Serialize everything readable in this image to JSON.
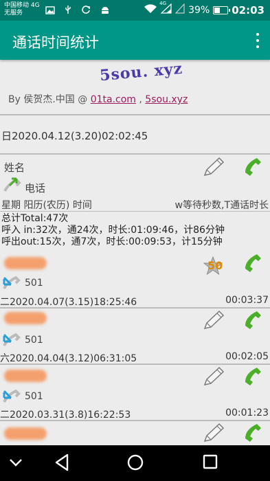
{
  "status_bar": {
    "carrier_line1": "中国移动 4G",
    "carrier_line2": "无服务",
    "network": "4G",
    "battery": "39%",
    "battery_level": 0.39,
    "time": "02:03"
  },
  "app_bar": {
    "title": "通话时间统计"
  },
  "header": {
    "logo": "5sou. xyz",
    "by_prefix": "By 侯贺杰.中国 @ ",
    "link1": "01ta.com",
    "separator": " , ",
    "link2": "5sou.xyz",
    "current_datetime": "日2020.04.12(3.20)02:02:45"
  },
  "legend": {
    "name_label": "姓名",
    "phone_label": "电话",
    "left": "星期 阳历(农历) 时间",
    "right": "w等待秒数,T通话时长"
  },
  "summary": {
    "line1": "总计Total:47次",
    "line2": "呼入 in:32次，通24次，时长:01:09:46，计86分钟",
    "line3": "呼出out:15次，通7次，时长:00:09:53，计15分钟"
  },
  "records": [
    {
      "number": "501",
      "datetime": "二2020.04.07(3.15)18:25:46",
      "duration": "00:03:37",
      "badge": "50"
    },
    {
      "number": "501",
      "datetime": "六2020.04.04(3.12)06:31:05",
      "duration": "00:02:05"
    },
    {
      "number": "501",
      "datetime": "二2020.03.31(3.8)16:22:53",
      "duration": "00:01:23"
    }
  ],
  "colors": {
    "status_bar": "#00796b",
    "app_bar": "#009688",
    "link": "#9c1b5e",
    "phone_green": "#4caf2a",
    "incoming_arrow": "#2a9fd6"
  }
}
